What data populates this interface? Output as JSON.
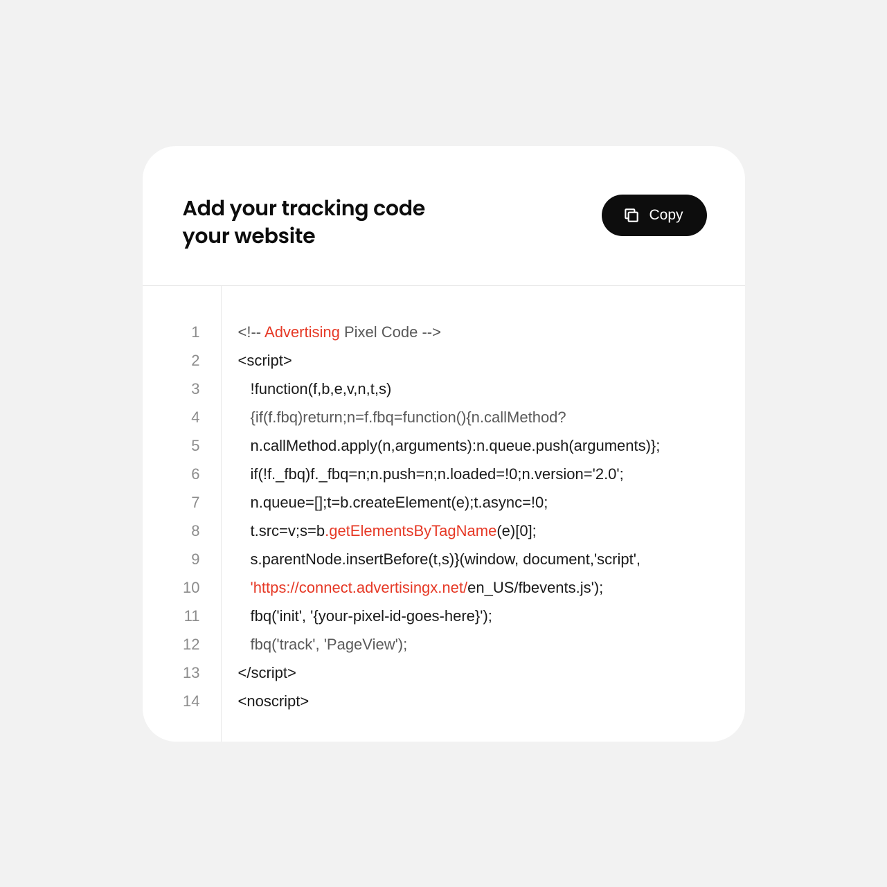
{
  "header": {
    "title_line1": "Add your tracking code",
    "title_line2": "your website",
    "copy_label": "Copy"
  },
  "colors": {
    "highlight": "#e63926",
    "muted": "#595959",
    "text": "#1a1a1a"
  },
  "code": {
    "lines": [
      {
        "num": "1",
        "segments": [
          {
            "text": "<!-- ",
            "cls": "muted"
          },
          {
            "text": "Advertising",
            "cls": "red"
          },
          {
            "text": " Pixel Code -->",
            "cls": "muted"
          }
        ]
      },
      {
        "num": "2",
        "segments": [
          {
            "text": "<script>",
            "cls": ""
          }
        ]
      },
      {
        "num": "3",
        "indent": true,
        "segments": [
          {
            "text": "!function(f,b,e,v,n,t,s)",
            "cls": ""
          }
        ]
      },
      {
        "num": "4",
        "indent": true,
        "segments": [
          {
            "text": "{if(f.fbq)return;n=f.fbq=function(){n.callMethod?",
            "cls": "muted"
          }
        ]
      },
      {
        "num": "5",
        "indent": true,
        "segments": [
          {
            "text": "n.callMethod.apply(n,arguments):n.queue.push(arguments)};",
            "cls": ""
          }
        ]
      },
      {
        "num": "6",
        "indent": true,
        "segments": [
          {
            "text": "if(!f._fbq)f._fbq=n;n.push=n;n.loaded=!0;n.version='2.0';",
            "cls": ""
          }
        ]
      },
      {
        "num": "7",
        "indent": true,
        "segments": [
          {
            "text": "n.queue=[];t=b.createElement(e);t.async=!0;",
            "cls": ""
          }
        ]
      },
      {
        "num": "8",
        "indent": true,
        "segments": [
          {
            "text": "t.src=v;s=b",
            "cls": ""
          },
          {
            "text": ".getElementsByTagName",
            "cls": "red"
          },
          {
            "text": "(e)[0];",
            "cls": ""
          }
        ]
      },
      {
        "num": "9",
        "indent": true,
        "segments": [
          {
            "text": "s.parentNode.insertBefore(t,s)}(window, document,'script',",
            "cls": ""
          }
        ]
      },
      {
        "num": "10",
        "indent": true,
        "segments": [
          {
            "text": "'https://connect.advertisingx.net/",
            "cls": "red"
          },
          {
            "text": "en_US/fbevents.js');",
            "cls": ""
          }
        ]
      },
      {
        "num": "11",
        "indent": true,
        "segments": [
          {
            "text": "fbq('init', '{your-pixel-id-goes-here}');",
            "cls": ""
          }
        ]
      },
      {
        "num": "12",
        "indent": true,
        "segments": [
          {
            "text": "fbq('track', 'PageView');",
            "cls": "muted"
          }
        ]
      },
      {
        "num": "13",
        "segments": [
          {
            "text": "</script>",
            "cls": ""
          }
        ]
      },
      {
        "num": "14",
        "segments": [
          {
            "text": "<noscript>",
            "cls": ""
          }
        ]
      }
    ]
  }
}
